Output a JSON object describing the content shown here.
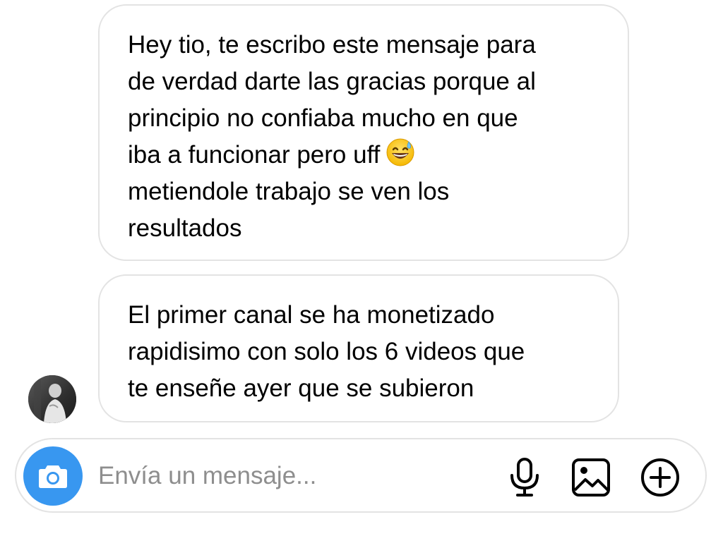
{
  "messages": [
    {
      "lines": [
        "Hey tio, te escribo este mensaje para",
        "de verdad darte las gracias porque al",
        "principio no confiaba mucho en que",
        "iba a funcionar pero uff",
        "metiendole trabajo se ven los",
        "resultados"
      ],
      "emoji": "grinning-face-with-sweat-icon"
    },
    {
      "lines": [
        "El primer canal se ha monetizado",
        "rapidisimo con solo los 6 videos que",
        "te enseñe ayer que se subieron"
      ]
    }
  ],
  "composer": {
    "placeholder": "Envía un mensaje...",
    "value": "",
    "camera_icon": "camera-icon",
    "mic_icon": "microphone-icon",
    "gallery_icon": "image-icon",
    "add_icon": "plus-circle-icon"
  },
  "colors": {
    "accent": "#3897f0",
    "bubble_border": "#e3e3e3",
    "placeholder": "#8e8e8e",
    "text": "#000000"
  }
}
